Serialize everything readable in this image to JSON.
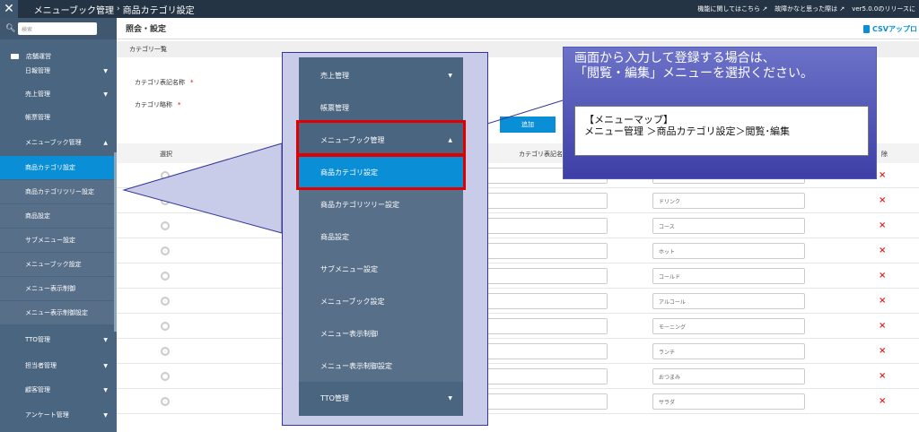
{
  "topbar": {
    "breadcrumb_parent": "メニューブック管理",
    "breadcrumb_sep": "›",
    "breadcrumb_current": "商品カテゴリ設定",
    "link_feature": "機能に関してはこちら",
    "link_trouble": "故障かなと思った際は",
    "link_version": "ver5.0.0のリリースに"
  },
  "sidebar": {
    "search_placeholder": "検索",
    "store": "店舗運営",
    "items": [
      {
        "label": "日報管理",
        "chevron": "▼"
      },
      {
        "label": "売上管理",
        "chevron": "▼"
      },
      {
        "label": "帳票管理",
        "chevron": ""
      },
      {
        "label": "メニューブック管理",
        "chevron": "▲"
      },
      {
        "label": "商品カテゴリ設定",
        "chevron": ""
      },
      {
        "label": "商品カテゴリツリー設定",
        "chevron": ""
      },
      {
        "label": "商品設定",
        "chevron": ""
      },
      {
        "label": "サブメニュー設定",
        "chevron": ""
      },
      {
        "label": "メニューブック設定",
        "chevron": ""
      },
      {
        "label": "メニュー表示制御",
        "chevron": ""
      },
      {
        "label": "メニュー表示制御設定",
        "chevron": ""
      },
      {
        "label": "TTO管理",
        "chevron": "▼"
      },
      {
        "label": "担当者管理",
        "chevron": "▼"
      },
      {
        "label": "顧客管理",
        "chevron": "▼"
      },
      {
        "label": "アンケート管理",
        "chevron": "▼"
      }
    ]
  },
  "main": {
    "page_title": "照会・設定",
    "csv_label": "CSVアップロ",
    "section": "カテゴリ一覧",
    "label_display_name": "カテゴリ表記名称",
    "label_short_name": "カテゴリ略称",
    "required": "*",
    "add_button": "追加",
    "col_select": "選択",
    "col_display_name": "カテゴリ表記名",
    "col_delete": "除",
    "rows": [
      {
        "short": ""
      },
      {
        "short": "ドリンク"
      },
      {
        "short": "コース"
      },
      {
        "short": "ホット"
      },
      {
        "short": "コールド"
      },
      {
        "short": "アルコール"
      },
      {
        "short": "モーニング"
      },
      {
        "short": "ランチ"
      },
      {
        "short": "おつまみ"
      },
      {
        "short": "サラダ"
      }
    ],
    "delete_glyph": "×"
  },
  "zoom_menu": {
    "items": [
      {
        "label": "売上管理",
        "chevron": "▼"
      },
      {
        "label": "帳票管理",
        "chevron": ""
      },
      {
        "label": "メニューブック管理",
        "chevron": "▲"
      },
      {
        "label": "商品カテゴリ設定",
        "chevron": ""
      },
      {
        "label": "商品カテゴリツリー設定",
        "chevron": ""
      },
      {
        "label": "商品設定",
        "chevron": ""
      },
      {
        "label": "サブメニュー設定",
        "chevron": ""
      },
      {
        "label": "メニューブック設定",
        "chevron": ""
      },
      {
        "label": "メニュー表示制御",
        "chevron": ""
      },
      {
        "label": "メニュー表示制御設定",
        "chevron": ""
      },
      {
        "label": "TTO管理",
        "chevron": "▼"
      }
    ]
  },
  "note": {
    "line1": "画面から入力して登録する場合は、",
    "line2": "「閲覧・編集」メニューを選択ください。",
    "map_title": "【メニューマップ】",
    "map_path": "メニュー管理 ＞商品カテゴリ設定＞閲覧･編集"
  },
  "colors": {
    "topbar": "#253444",
    "sidebar": "#4a6580",
    "active": "#0a8fd6",
    "highlight": "#e00000",
    "note_bg": "#4f55b8"
  }
}
